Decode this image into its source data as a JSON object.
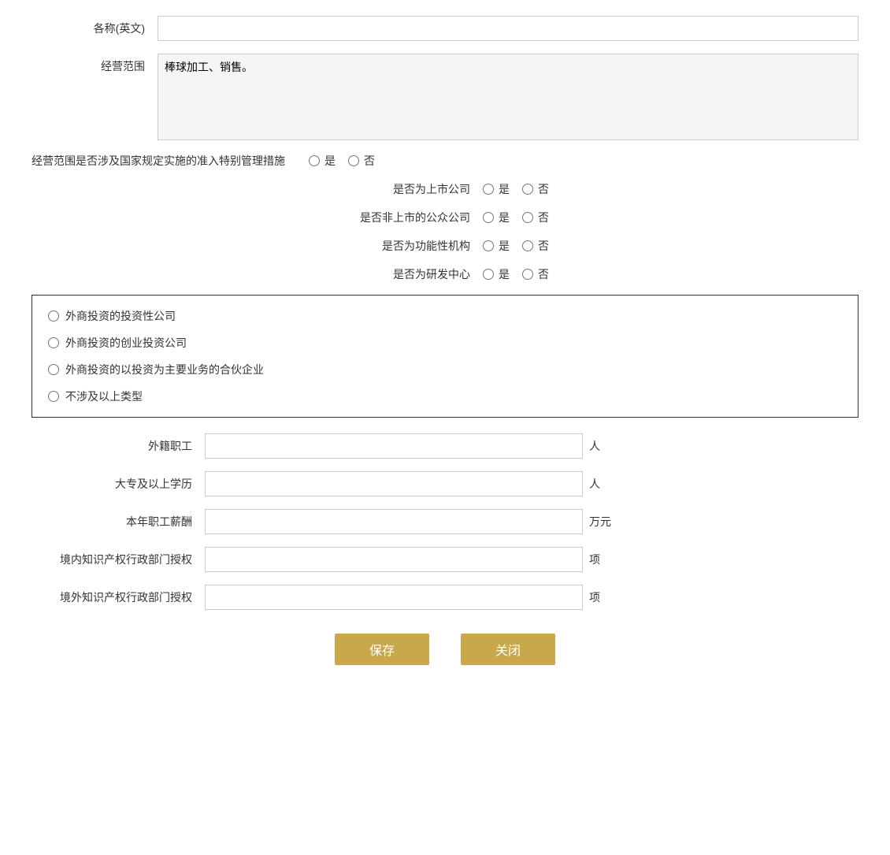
{
  "form": {
    "name_en_label": "各称(英文)",
    "name_en_placeholder": "",
    "business_scope_label": "经营范围",
    "business_scope_value": "棒球加工、销售。",
    "special_mgmt_label": "经营范围是否涉及国家规定实施的准入特别管理措施",
    "yes_label": "是",
    "no_label": "否",
    "listed_company_label": "是否为上市公司",
    "non_listed_public_label": "是否非上市的公众公司",
    "functional_org_label": "是否为功能性机构",
    "rd_center_label": "是否为研发中心",
    "box_items": [
      "外商投资的投资性公司",
      "外商投资的创业投资公司",
      "外商投资的以投资为主要业务的合伙企业",
      "不涉及以上类型"
    ],
    "foreign_staff_label": "外籍职工",
    "foreign_staff_unit": "人",
    "college_edu_label": "大专及以上学历",
    "college_edu_unit": "人",
    "annual_salary_label": "本年职工薪酬",
    "annual_salary_unit": "万元",
    "domestic_ip_label": "境内知识产权行政部门授权",
    "domestic_ip_unit": "项",
    "overseas_ip_label": "境外知识产权行政部门授权",
    "overseas_ip_unit": "项",
    "save_label": "保存",
    "close_label": "关闭"
  }
}
